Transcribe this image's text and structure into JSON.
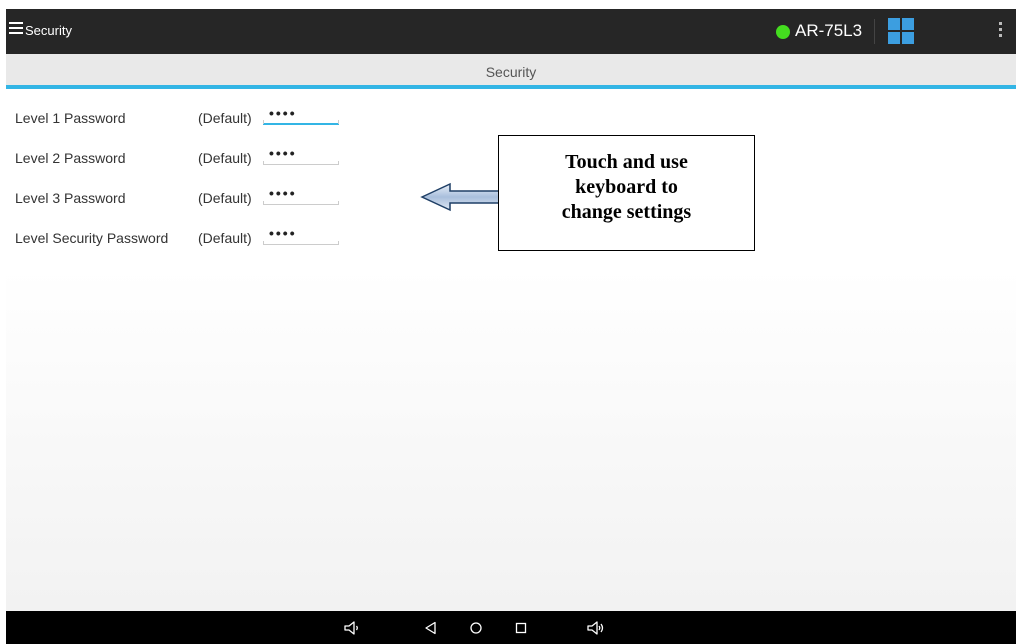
{
  "app_bar": {
    "title": "Security",
    "device_name": "AR-75L3",
    "status_color": "#44dd1f",
    "accent_color": "#33b5e5"
  },
  "section": {
    "title": "Security"
  },
  "password_rows": [
    {
      "label": "Level 1 Password",
      "default_text": "(Default)",
      "masked_value": "••••",
      "focused": true
    },
    {
      "label": "Level 2 Password",
      "default_text": "(Default)",
      "masked_value": "••••",
      "focused": false
    },
    {
      "label": "Level 3 Password",
      "default_text": "(Default)",
      "masked_value": "••••",
      "focused": false
    },
    {
      "label": "Level Security Password",
      "default_text": "(Default)",
      "masked_value": "••••",
      "focused": false
    }
  ],
  "callout": {
    "lines": [
      "Touch and use",
      "keyboard to",
      "change settings"
    ]
  },
  "icons": {
    "menu": "hamburger-menu-icon",
    "device_status": "status-dot-icon",
    "apps": "grid-apps-icon",
    "overflow": "overflow-menu-icon",
    "nav": [
      "volume-down-icon",
      "back-icon",
      "home-icon",
      "recents-icon",
      "volume-up-icon"
    ]
  }
}
